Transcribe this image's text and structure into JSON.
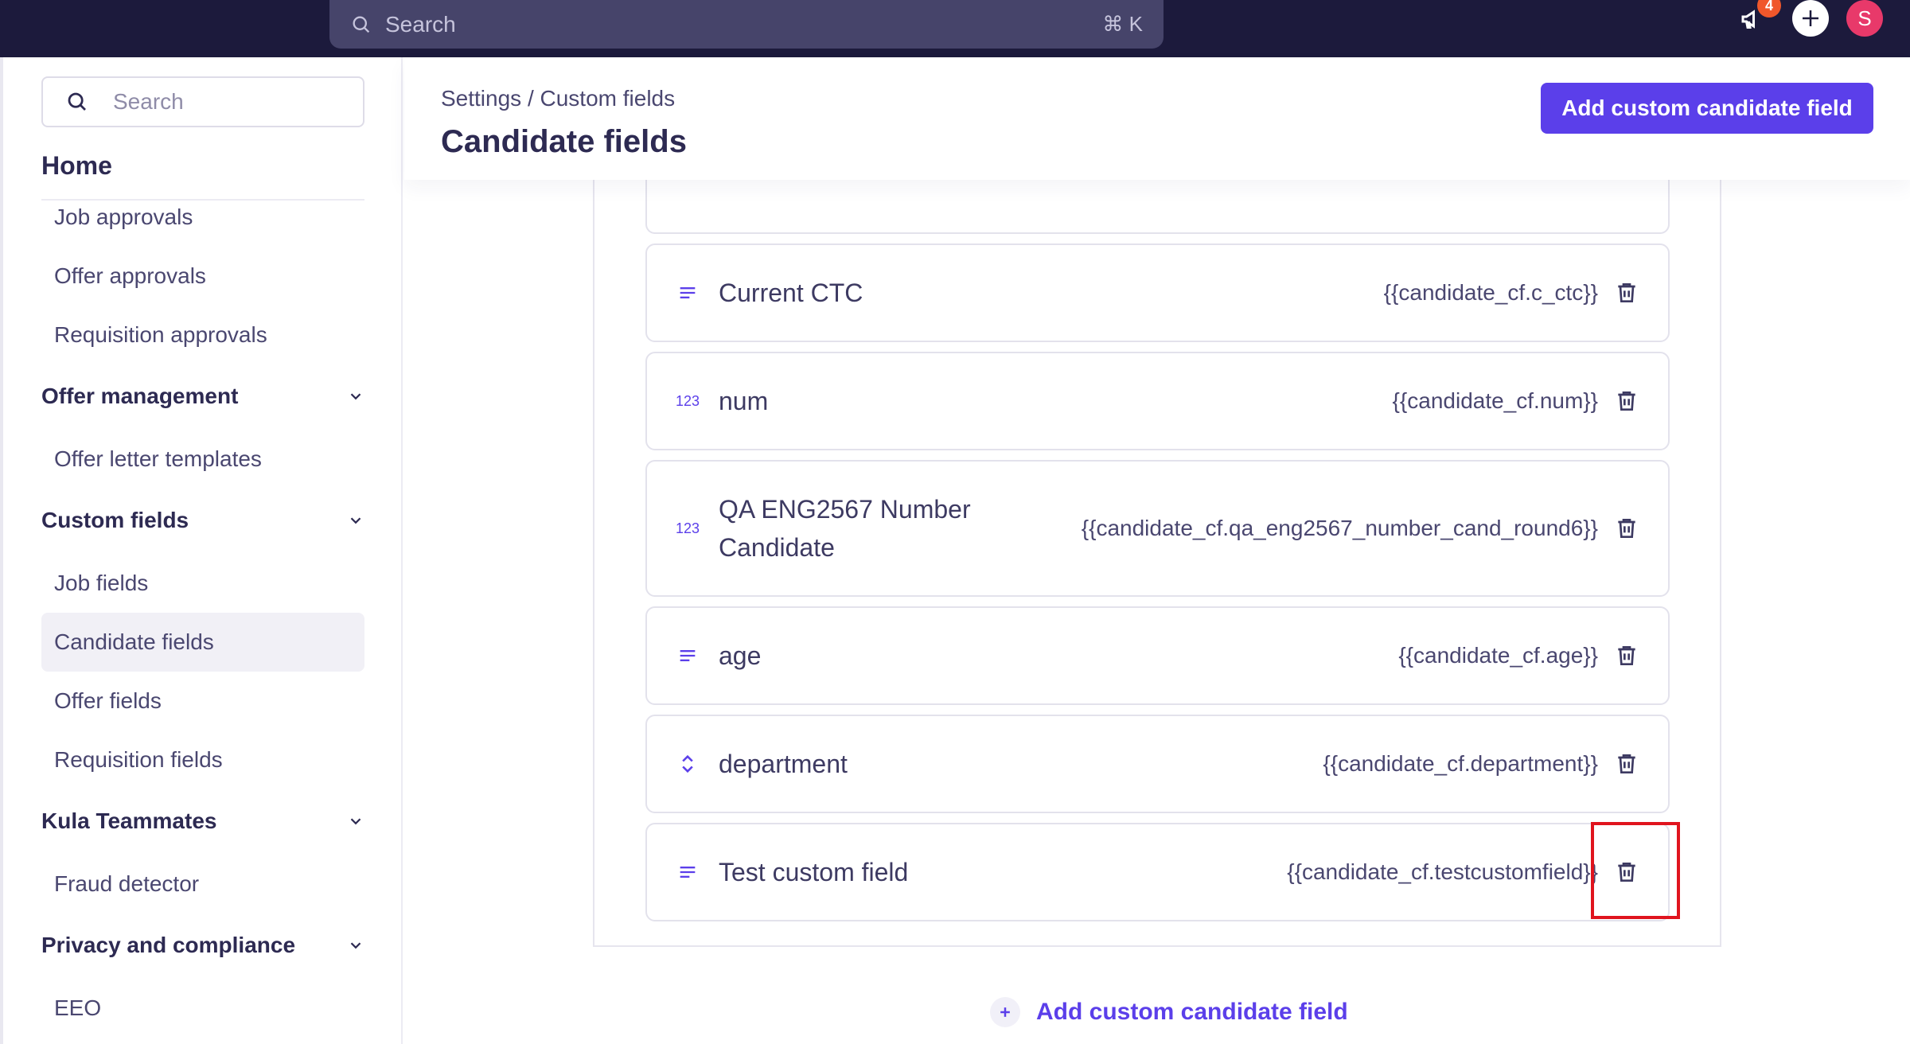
{
  "topbar": {
    "search_placeholder": "Search",
    "shortcut": "⌘ K",
    "notification_count": "4",
    "avatar_initial": "S"
  },
  "sidebar": {
    "search_placeholder": "Search",
    "home_label": "Home",
    "approvals": [
      "Job approvals",
      "Offer approvals",
      "Requisition approvals"
    ],
    "offer_management": {
      "label": "Offer management",
      "items": [
        "Offer letter templates"
      ]
    },
    "custom_fields": {
      "label": "Custom fields",
      "items": [
        "Job fields",
        "Candidate fields",
        "Offer fields",
        "Requisition fields"
      ],
      "active": "Candidate fields"
    },
    "kula_teammates": {
      "label": "Kula Teammates",
      "items": [
        "Fraud detector"
      ]
    },
    "privacy": {
      "label": "Privacy and compliance",
      "items": [
        "EEO"
      ]
    }
  },
  "header": {
    "breadcrumb": "Settings / Custom fields",
    "title": "Candidate fields",
    "add_button": "Add custom candidate field"
  },
  "fields": [
    {
      "icon": "text-lines-icon",
      "name": "Current CTC",
      "key": "{{candidate_cf.c_ctc}}"
    },
    {
      "icon": "number-icon",
      "name": "num",
      "key": "{{candidate_cf.num}}"
    },
    {
      "icon": "number-icon",
      "name_line1": "QA ENG2567 Number",
      "name_line2": "Candidate",
      "key": "{{candidate_cf.qa_eng2567_number_cand_round6}}"
    },
    {
      "icon": "text-lines-icon",
      "name": "age",
      "key": "{{candidate_cf.age}}"
    },
    {
      "icon": "select-chevrons-icon",
      "name": "department",
      "key": "{{candidate_cf.department}}"
    },
    {
      "icon": "text-lines-icon",
      "name": "Test custom field",
      "key": "{{candidate_cf.testcustomfield}}"
    }
  ],
  "number_icon_text": "123",
  "footer": {
    "add_link": "Add custom candidate field"
  },
  "colors": {
    "accent": "#5b3fea",
    "topbar": "#1c1a3c",
    "highlight": "#e0141e"
  }
}
